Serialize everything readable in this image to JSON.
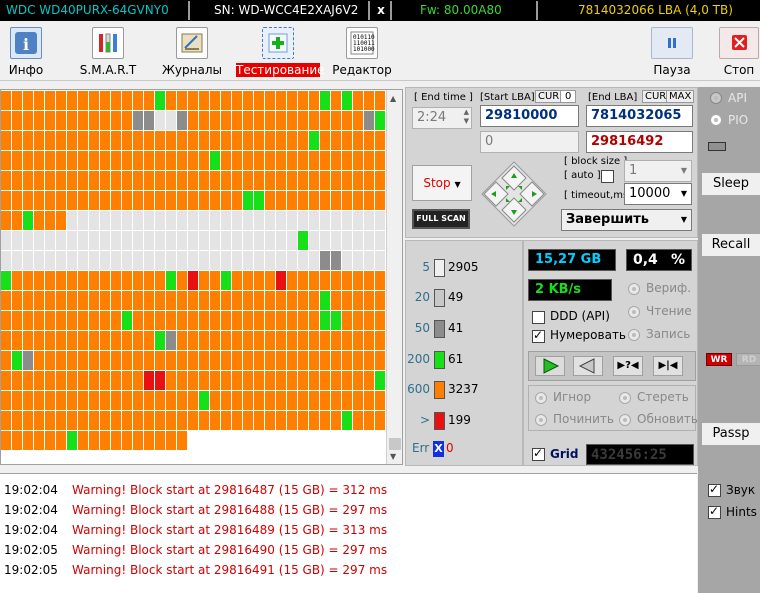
{
  "topbar": {
    "model": "WDC WD40PURX-64GVNY0",
    "serial": "SN: WD-WCC4E2XAJ6V2",
    "close": "x",
    "firmware": "Fw: 80.00A80",
    "capacity": "7814032066 LBA (4,0 TB)",
    "colors": {
      "model": "#00c8c8",
      "serial": "#ffffff",
      "firmware": "#38d838",
      "capacity": "#f0d000"
    }
  },
  "toolbar": {
    "info": "Инфо",
    "smart": "S.M.A.R.T",
    "journals": "Журналы",
    "testing": "Тестирование",
    "editor": "Редактор",
    "pause": "Пауза",
    "stop": "Стоп"
  },
  "params": {
    "end_time_label": "[ End time ]",
    "end_time_value": "2:24",
    "start_lba_label": "[Start LBA]",
    "cur_label": "CUR",
    "cur_value": "0",
    "end_lba_label": "[End LBA]",
    "max_label": "MAX",
    "start_lba": "29810000",
    "end_lba": "7814032065",
    "start_lba2": "0",
    "current_lba": "29816492",
    "stop_label": "Stop",
    "full_scan": "FULL SCAN",
    "block_size_label": "[ block size ]",
    "auto_label": "[ auto ]",
    "timeout_label": "[ timeout,ms ]",
    "block_size_value": "1",
    "timeout_value": "10000",
    "finish_action": "Завершить"
  },
  "stats": {
    "legend": [
      {
        "label": "5",
        "count": "2905",
        "color": "#f0f0f0"
      },
      {
        "label": "20",
        "count": "49",
        "color": "#c8c8c8"
      },
      {
        "label": "50",
        "count": "41",
        "color": "#8c8c8c"
      },
      {
        "label": "200",
        "count": "61",
        "color": "#18e018"
      },
      {
        "label": "600",
        "count": "3237",
        "color": "#ff8000"
      },
      {
        "label": ">",
        "count": "199",
        "color": "#e81010"
      }
    ],
    "err_label": "Err",
    "err_count": "0",
    "position": "15,27 GB",
    "percent": "0,4",
    "percent_unit": "%",
    "speed": "2 KB/s",
    "verify": "Вериф.",
    "read": "Чтение",
    "write": "Запись",
    "ddd": "DDD (API)",
    "numerate": "Нумеровать",
    "ignore": "Игнор",
    "erase": "Стереть",
    "repair": "Починить",
    "refresh": "Обновить",
    "grid_label": "Grid",
    "grid_lcd": "432456:25"
  },
  "right": {
    "api": "API",
    "pio": "PIO",
    "sleep": "Sleep",
    "recall": "Recall",
    "wr": "WR",
    "rd": "RD",
    "passp": "Passp",
    "sound": "Звук",
    "hints": "Hints"
  },
  "log": [
    {
      "time": "19:02:04",
      "msg": "Warning! Block start at 29816487 (15 GB)  = 312 ms"
    },
    {
      "time": "19:02:04",
      "msg": "Warning! Block start at 29816488 (15 GB)  = 297 ms"
    },
    {
      "time": "19:02:04",
      "msg": "Warning! Block start at 29816489 (15 GB)  = 313 ms"
    },
    {
      "time": "19:02:05",
      "msg": "Warning! Block start at 29816490 (15 GB)  = 297 ms"
    },
    {
      "time": "19:02:05",
      "msg": "Warning! Block start at 29816491 (15 GB)  = 297 ms"
    }
  ]
}
